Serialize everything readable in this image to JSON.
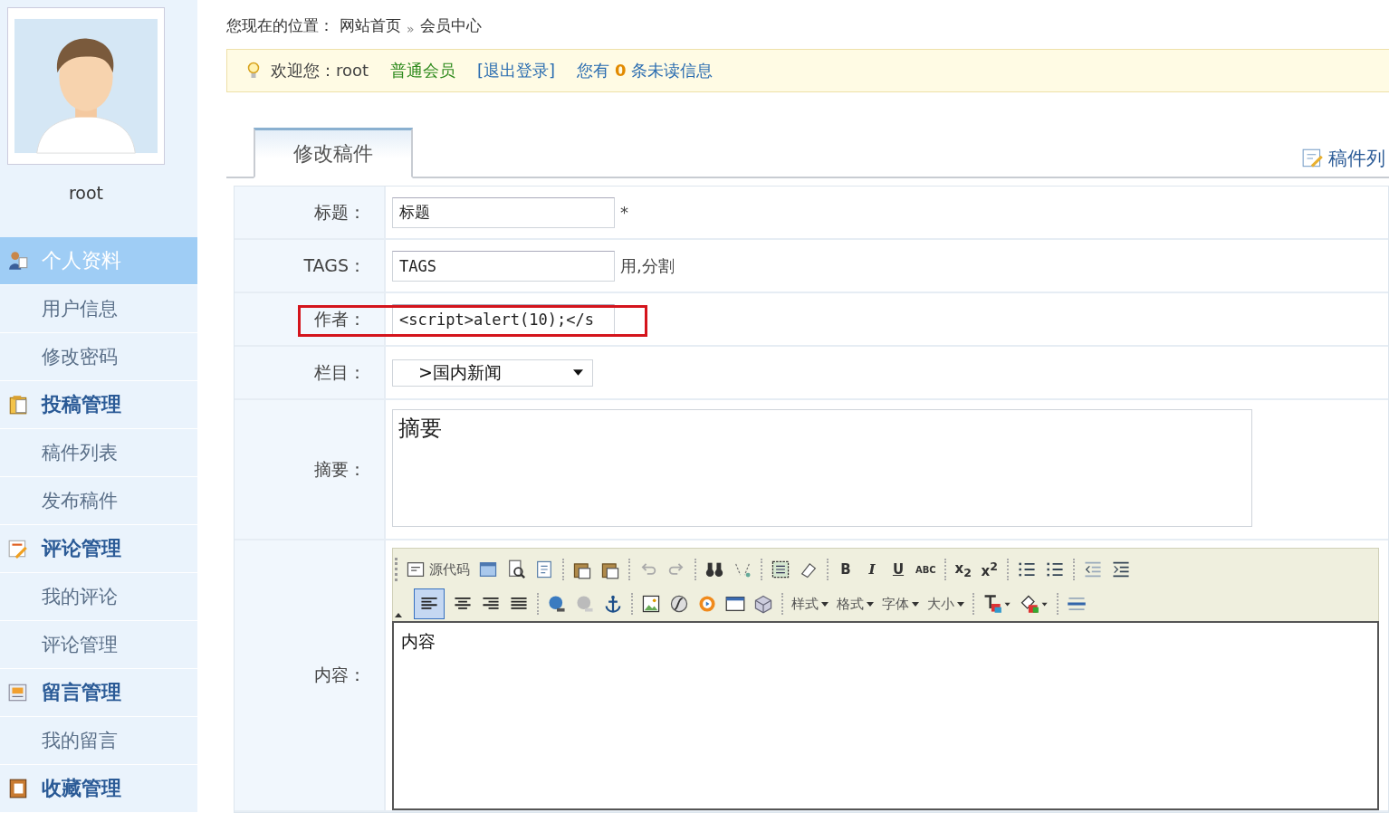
{
  "profile": {
    "username": "root"
  },
  "sidebar": {
    "sections": [
      {
        "title": "个人资料",
        "selected": true,
        "items": [
          {
            "label": "用户信息"
          },
          {
            "label": "修改密码"
          }
        ]
      },
      {
        "title": "投稿管理",
        "selected": false,
        "items": [
          {
            "label": "稿件列表"
          },
          {
            "label": "发布稿件"
          }
        ]
      },
      {
        "title": "评论管理",
        "selected": false,
        "items": [
          {
            "label": "我的评论"
          },
          {
            "label": "评论管理"
          }
        ]
      },
      {
        "title": "留言管理",
        "selected": false,
        "items": [
          {
            "label": "我的留言"
          }
        ]
      },
      {
        "title": "收藏管理",
        "selected": false
      }
    ]
  },
  "breadcrumb": {
    "label": "您现在的位置：",
    "links": [
      "网站首页",
      "会员中心"
    ],
    "separator": "»"
  },
  "welcome": {
    "greeting": "欢迎您：root",
    "member_level": "普通会员",
    "logout": "[退出登录]",
    "unread_prefix": "您有",
    "unread_count": "0",
    "unread_suffix": "条未读信息"
  },
  "tabs": [
    {
      "label": "修改稿件",
      "selected": true
    }
  ],
  "list_link": "稿件列",
  "form": {
    "rows": [
      {
        "kind": "text",
        "label": "标题：",
        "value": "标题",
        "note": "*"
      },
      {
        "kind": "text",
        "label": "TAGS：",
        "value": "TAGS",
        "note": "用,分割"
      },
      {
        "kind": "text",
        "label": "作者：",
        "value": "<script>alert(10);</s",
        "highlighted": true
      },
      {
        "kind": "select",
        "label": "栏目：",
        "value": ">国内新闻"
      },
      {
        "kind": "textarea",
        "label": "摘要：",
        "value": "摘要"
      },
      {
        "kind": "editor",
        "label": "内容：",
        "value": "内容"
      }
    ]
  },
  "editor_toolbar": {
    "source_label": "源代码",
    "format_buttons": [
      "B",
      "I",
      "U",
      "ABC"
    ],
    "script_buttons": [
      "x$_{2}$",
      "x$^{2}$"
    ],
    "dropdowns": [
      "样式",
      "格式",
      "字体",
      "大小"
    ]
  }
}
